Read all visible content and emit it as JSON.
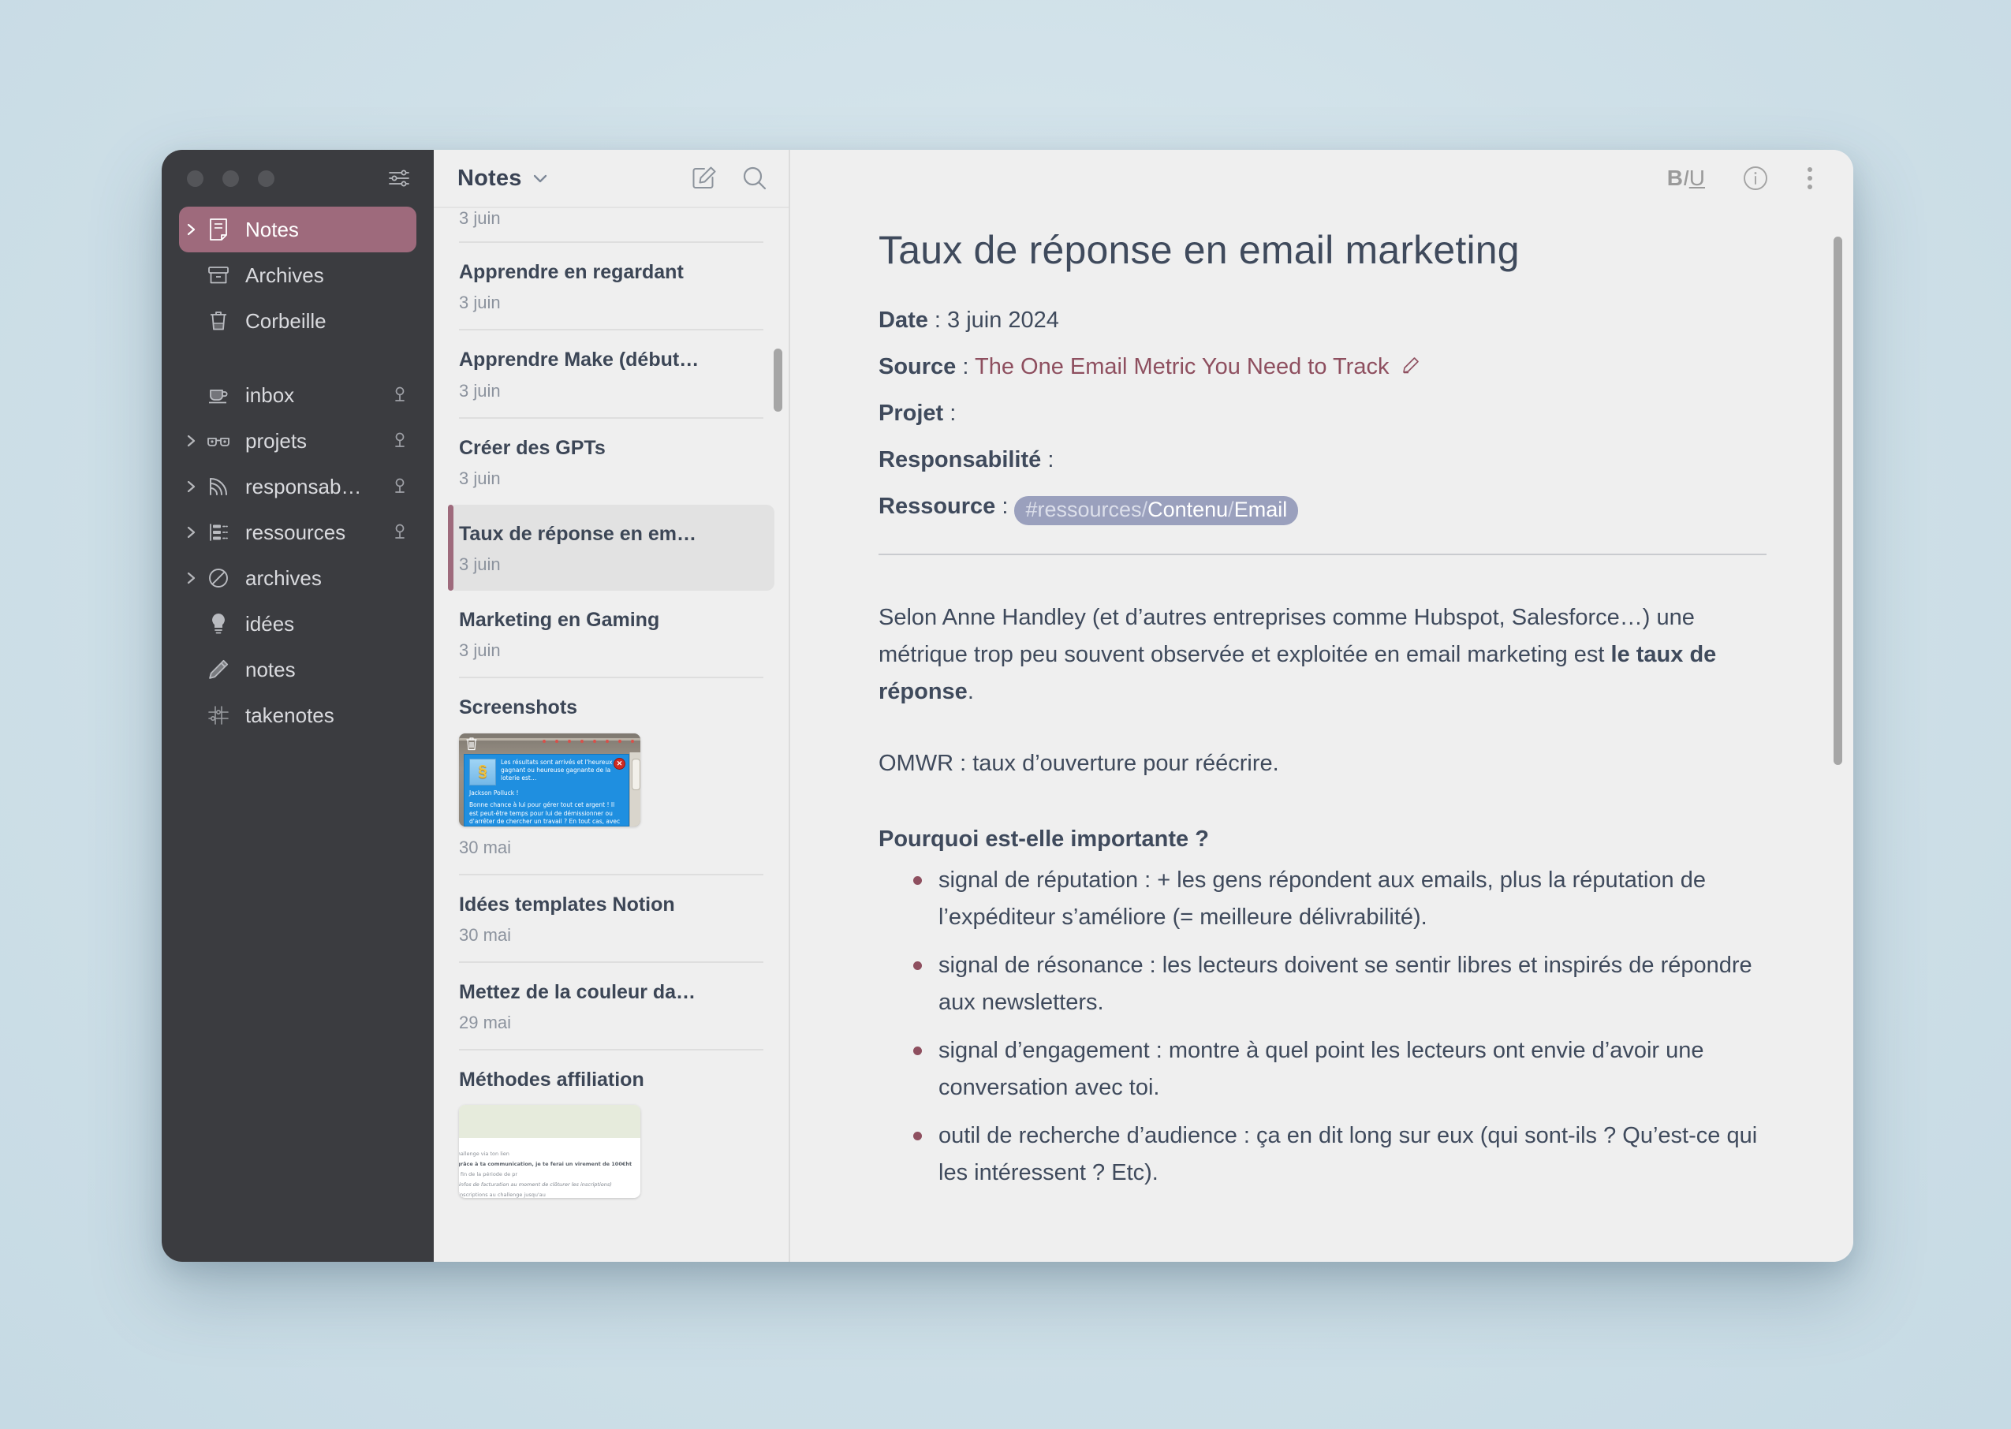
{
  "window": {
    "traffic_lights": [
      "close",
      "minimize",
      "zoom"
    ],
    "sidebar_toggle_icon": "sliders-icon"
  },
  "sidebar": {
    "top_items": [
      {
        "label": "Notes",
        "icon": "note-icon",
        "caret": true,
        "active": true,
        "pin": false
      },
      {
        "label": "Archives",
        "icon": "archive-icon",
        "caret": false,
        "active": false,
        "pin": false
      },
      {
        "label": "Corbeille",
        "icon": "trash-icon",
        "caret": false,
        "active": false,
        "pin": false
      }
    ],
    "tag_items": [
      {
        "label": "inbox",
        "icon": "cup-icon",
        "caret": false,
        "pin": true
      },
      {
        "label": "projets",
        "icon": "glasses-icon",
        "caret": true,
        "pin": true
      },
      {
        "label": "responsab…",
        "icon": "rss-icon",
        "caret": true,
        "pin": true
      },
      {
        "label": "ressources",
        "icon": "list-tree-icon",
        "caret": true,
        "pin": true
      },
      {
        "label": "archives",
        "icon": "no-entry-icon",
        "caret": true,
        "pin": false
      },
      {
        "label": "idées",
        "icon": "bulb-icon",
        "caret": false,
        "pin": false
      },
      {
        "label": "notes",
        "icon": "pencil-icon",
        "caret": false,
        "pin": false
      },
      {
        "label": "takenotes",
        "icon": "hash-slider-icon",
        "caret": false,
        "pin": false
      }
    ]
  },
  "notelist": {
    "title": "Notes",
    "dropdown_icon": "chevron-down-icon",
    "compose_icon": "compose-icon",
    "search_icon": "search-icon",
    "items": [
      {
        "name": "",
        "date": "3 juin",
        "selected": false,
        "thumb": null
      },
      {
        "name": "Apprendre en regardant",
        "date": "3 juin",
        "selected": false,
        "thumb": null
      },
      {
        "name": "Apprendre Make (début…",
        "date": "3 juin",
        "selected": false,
        "thumb": null
      },
      {
        "name": "Créer des GPTs",
        "date": "3 juin",
        "selected": false,
        "thumb": null
      },
      {
        "name": "Taux de réponse en em…",
        "date": "3 juin",
        "selected": true,
        "thumb": null
      },
      {
        "name": "Marketing en Gaming",
        "date": "3 juin",
        "selected": false,
        "thumb": null
      },
      {
        "name": "Screenshots",
        "date": "30 mai",
        "selected": false,
        "thumb": "sims"
      },
      {
        "name": "Idées templates Notion",
        "date": "30 mai",
        "selected": false,
        "thumb": null
      },
      {
        "name": "Mettez de la couleur da…",
        "date": "29 mai",
        "selected": false,
        "thumb": null
      },
      {
        "name": "Méthodes affiliation",
        "date": "",
        "selected": false,
        "thumb": "doc"
      }
    ],
    "thumb_sims": {
      "delete_icon": "trash-icon",
      "close_icon": "close-icon",
      "coin_glyph": "§",
      "headline": "Les résultats sont arrivés et l'heureux gagnant ou heureuse gagnante de la loterie est…",
      "winner": "Jackson Polluck  !",
      "body": "Bonne chance à lui pour gérer tout cet argent  ! Il est peut-être temps pour lui de démissionner ou d'arrêter de chercher un travail  ? En tout cas, avec un gain"
    },
    "thumb_doc": {
      "line1": "u challenge via ton lien",
      "line2_a": "ts grâce à ta communication, je te ferai un ",
      "line2_b": "virement de 100€ht",
      "line2_c": " à la fin de la période de pr",
      "line3": "tes infos de facturation au moment de clôturer les inscriptions)",
      "line4": "les inscriptions au challenge jusqu'au"
    }
  },
  "editor": {
    "toolbar": {
      "format_bold": "B",
      "format_italic": "I",
      "format_underline": "U",
      "info_icon": "info-icon",
      "more_icon": "more-vertical-icon"
    },
    "title": "Taux de réponse en email marketing",
    "meta": [
      {
        "key": "Date",
        "sep": " : ",
        "value": "3 juin 2024",
        "kind": "text"
      },
      {
        "key": "Source",
        "sep": " : ",
        "value": "The One Email Metric You Need to Track",
        "kind": "link",
        "edit_icon": "pencil-icon"
      },
      {
        "key": "Projet",
        "sep": " :",
        "value": "",
        "kind": "text"
      },
      {
        "key": "Responsabilité",
        "sep": " :",
        "value": "",
        "kind": "text"
      },
      {
        "key": "Ressource",
        "sep": " : ",
        "value": "",
        "kind": "tag"
      }
    ],
    "tag": {
      "hash": "#",
      "parts": [
        "ressources",
        "Contenu",
        "Email"
      ],
      "separator": "/"
    },
    "paragraph_1_a": "Selon Anne Handley (et d’autres entreprises comme Hubspot, Salesforce…) une métrique trop peu souvent observée et exploitée en email marketing est ",
    "paragraph_1_b": "le taux de réponse",
    "paragraph_1_c": ".",
    "paragraph_2": "OMWR : taux d’ouverture pour réécrire.",
    "subheading": "Pourquoi est-elle importante ?",
    "bullets": [
      "signal de réputation : + les gens répondent aux emails, plus la réputation de l’expéditeur s’améliore (= meilleure délivrabilité).",
      "signal de résonance : les lecteurs doivent se sentir libres et inspirés de répondre aux newsletters.",
      "signal d’engagement : montre à quel point les lecteurs ont envie d’avoir une conversation avec toi.",
      "outil de recherche d’audience : ça en dit long sur eux (qui sont-ils ? Qu’est-ce qui les intéressent ? Etc)."
    ]
  },
  "colors": {
    "accent": "#9e6a7c",
    "sidebar_bg": "#3b3c40",
    "panel_bg": "#efefef",
    "text": "#3f4a5c",
    "link": "#8e4f5f",
    "tag_bg": "#9aa0bd",
    "desktop_bg": "#cfe0e8"
  }
}
